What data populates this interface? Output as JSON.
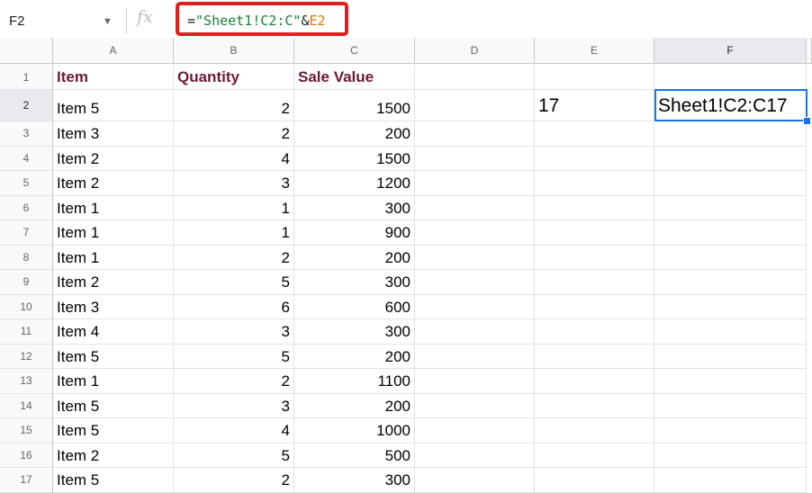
{
  "formula_bar": {
    "name_box": "F2",
    "caret": "▼",
    "fx": "fx",
    "formula_eq": "=",
    "formula_str": "\"Sheet1!C2:C\"",
    "formula_amp": "&",
    "formula_ref": "E2",
    "highlight_color": "#e01e1e"
  },
  "sheet": {
    "columns": [
      "A",
      "B",
      "C",
      "D",
      "E",
      "F"
    ],
    "row_numbers": [
      "1",
      "2",
      "3",
      "4",
      "5",
      "6",
      "7",
      "8",
      "9",
      "10",
      "11",
      "12",
      "13",
      "14",
      "15",
      "16",
      "17"
    ],
    "headers": {
      "item": "Item",
      "quantity": "Quantity",
      "sale_value": "Sale Value"
    },
    "rows": [
      {
        "item": "Item 5",
        "qty": "2",
        "sale": "1500"
      },
      {
        "item": "Item 3",
        "qty": "2",
        "sale": "200"
      },
      {
        "item": "Item 2",
        "qty": "4",
        "sale": "1500"
      },
      {
        "item": "Item 2",
        "qty": "3",
        "sale": "1200"
      },
      {
        "item": "Item 1",
        "qty": "1",
        "sale": "300"
      },
      {
        "item": "Item 1",
        "qty": "1",
        "sale": "900"
      },
      {
        "item": "Item 1",
        "qty": "2",
        "sale": "200"
      },
      {
        "item": "Item 2",
        "qty": "5",
        "sale": "300"
      },
      {
        "item": "Item 3",
        "qty": "6",
        "sale": "600"
      },
      {
        "item": "Item 4",
        "qty": "3",
        "sale": "300"
      },
      {
        "item": "Item 5",
        "qty": "5",
        "sale": "200"
      },
      {
        "item": "Item 1",
        "qty": "2",
        "sale": "1100"
      },
      {
        "item": "Item 5",
        "qty": "3",
        "sale": "200"
      },
      {
        "item": "Item 5",
        "qty": "4",
        "sale": "1000"
      },
      {
        "item": "Item 2",
        "qty": "5",
        "sale": "500"
      },
      {
        "item": "Item 5",
        "qty": "2",
        "sale": "300"
      }
    ],
    "e2": "17",
    "f2": "Sheet1!C2:C17",
    "selected_cell": "F2",
    "header_text_color": "#6b1a35",
    "selection_color": "#1a73e8"
  }
}
